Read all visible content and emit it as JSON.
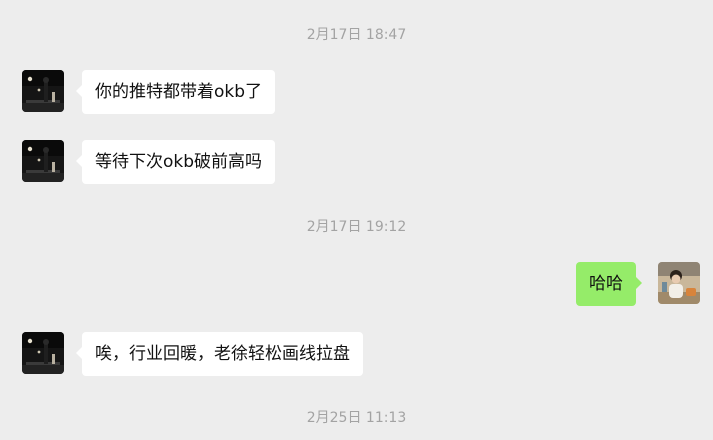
{
  "timestamps": [
    "2月17日 18:47",
    "2月17日 19:12",
    "2月25日 11:13"
  ],
  "messages": [
    {
      "side": "left",
      "text": "你的推特都带着okb了"
    },
    {
      "side": "left",
      "text": "等待下次okb破前高吗"
    },
    {
      "side": "right",
      "text": "哈哈"
    },
    {
      "side": "left",
      "text": "唉，行业回暖，老徐轻松画线拉盘"
    }
  ],
  "colors": {
    "background": "#ededed",
    "incoming_bubble": "#ffffff",
    "outgoing_bubble": "#95ec69",
    "timestamp_text": "#a3a3a3"
  }
}
